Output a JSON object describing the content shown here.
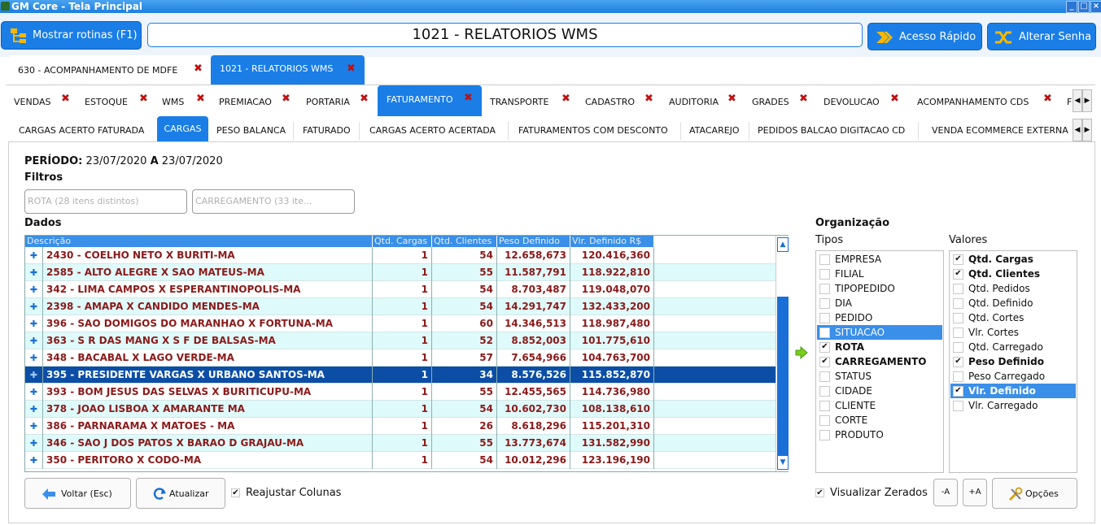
{
  "window": {
    "title": "GM Core - Tela Principal",
    "controls": [
      "_",
      "□",
      "×"
    ]
  },
  "header": {
    "routines_label": "Mostrar rotinas (F1)",
    "title": "1021 - RELATORIOS WMS",
    "quick_access_label": "Acesso Rápido",
    "change_password_label": "Alterar Senha"
  },
  "main_tabs": [
    {
      "label": "630 - ACOMPANHAMENTO DE MDFE",
      "active": false
    },
    {
      "label": "1021 - RELATORIOS WMS",
      "active": true
    }
  ],
  "module_tabs": [
    {
      "label": "VENDAS"
    },
    {
      "label": "ESTOQUE"
    },
    {
      "label": "WMS"
    },
    {
      "label": "PREMIACAO"
    },
    {
      "label": "PORTARIA"
    },
    {
      "label": "FATURAMENTO",
      "active": true
    },
    {
      "label": "TRANSPORTE"
    },
    {
      "label": "CADASTRO"
    },
    {
      "label": "AUDITORIA"
    },
    {
      "label": "GRADES"
    },
    {
      "label": "DEVOLUCAO"
    },
    {
      "label": "ACOMPANHAMENTO CDS"
    },
    {
      "label": "F"
    }
  ],
  "sub_tabs": [
    {
      "label": "CARGAS ACERTO FATURADA"
    },
    {
      "label": "CARGAS",
      "active": true
    },
    {
      "label": "PESO BALANCA"
    },
    {
      "label": "FATURADO"
    },
    {
      "label": "CARGAS ACERTO ACERTADA"
    },
    {
      "label": "FATURAMENTOS COM DESCONTO"
    },
    {
      "label": "ATACAREJO"
    },
    {
      "label": "PEDIDOS BALCAO DIGITACAO CD"
    },
    {
      "label": "VENDA ECOMMERCE EXTERNA"
    }
  ],
  "period": {
    "label": "PERÍODO:",
    "start": "23/07/2020",
    "connector": "A",
    "end": "23/07/2020"
  },
  "filters": {
    "title": "Filtros",
    "rota_placeholder": "ROTA (28 itens distintos)",
    "carregamento_placeholder": "CARREGAMENTO (33 ite..."
  },
  "grid": {
    "title": "Dados",
    "columns": [
      "Descrição",
      "Qtd. Cargas",
      "Qtd. Clientes",
      "Peso Definido",
      "Vlr. Definido R$"
    ],
    "rows": [
      {
        "desc": "2430 - COELHO NETO X BURITI-MA",
        "cargas": "1",
        "clientes": "54",
        "peso": "12.658,673",
        "valor": "120.416,360"
      },
      {
        "desc": "2585 - ALTO ALEGRE X SAO MATEUS-MA",
        "cargas": "1",
        "clientes": "55",
        "peso": "11.587,791",
        "valor": "118.922,810"
      },
      {
        "desc": "342 - LIMA CAMPOS X ESPERANTINOPOLIS-MA",
        "cargas": "1",
        "clientes": "54",
        "peso": "8.703,487",
        "valor": "119.048,070"
      },
      {
        "desc": "2398 - AMAPA X CANDIDO MENDES-MA",
        "cargas": "1",
        "clientes": "54",
        "peso": "14.291,747",
        "valor": "132.433,200"
      },
      {
        "desc": "396 - SAO DOMIGOS DO MARANHAO X FORTUNA-MA",
        "cargas": "1",
        "clientes": "60",
        "peso": "14.346,513",
        "valor": "118.987,480"
      },
      {
        "desc": "363 - S R DAS MANG X S F DE BALSAS-MA",
        "cargas": "1",
        "clientes": "52",
        "peso": "8.852,003",
        "valor": "101.775,610"
      },
      {
        "desc": "348 - BACABAL X LAGO VERDE-MA",
        "cargas": "1",
        "clientes": "57",
        "peso": "7.654,966",
        "valor": "104.763,700"
      },
      {
        "desc": "395 - PRESIDENTE VARGAS X URBANO SANTOS-MA",
        "cargas": "1",
        "clientes": "34",
        "peso": "8.576,526",
        "valor": "115.852,870",
        "selected": true
      },
      {
        "desc": "393 - BOM JESUS DAS SELVAS X BURITICUPU-MA",
        "cargas": "1",
        "clientes": "55",
        "peso": "12.455,565",
        "valor": "114.736,980"
      },
      {
        "desc": "378 - JOAO LISBOA  X AMARANTE  MA",
        "cargas": "1",
        "clientes": "54",
        "peso": "10.602,730",
        "valor": "108.138,610"
      },
      {
        "desc": "386 - PARNARAMA X MATOES - MA",
        "cargas": "1",
        "clientes": "26",
        "peso": "8.618,296",
        "valor": "115.201,310"
      },
      {
        "desc": "346 - SAO J DOS PATOS X BARAO D GRAJAU-MA",
        "cargas": "1",
        "clientes": "55",
        "peso": "13.773,674",
        "valor": "131.582,990"
      },
      {
        "desc": "350 - PERITORO X CODO-MA",
        "cargas": "1",
        "clientes": "54",
        "peso": "10.012,296",
        "valor": "123.196,190"
      }
    ]
  },
  "organization": {
    "title": "Organização",
    "types_label": "Tipos",
    "values_label": "Valores",
    "types": [
      {
        "label": "EMPRESA",
        "checked": false
      },
      {
        "label": "FILIAL",
        "checked": false
      },
      {
        "label": "TIPOPEDIDO",
        "checked": false
      },
      {
        "label": "DIA",
        "checked": false
      },
      {
        "label": "PEDIDO",
        "checked": false
      },
      {
        "label": "SITUACAO",
        "checked": false,
        "selected": true
      },
      {
        "label": "ROTA",
        "checked": true
      },
      {
        "label": "CARREGAMENTO",
        "checked": true
      },
      {
        "label": "STATUS",
        "checked": false
      },
      {
        "label": "CIDADE",
        "checked": false
      },
      {
        "label": "CLIENTE",
        "checked": false
      },
      {
        "label": "CORTE",
        "checked": false
      },
      {
        "label": "PRODUTO",
        "checked": false
      }
    ],
    "values": [
      {
        "label": "Qtd. Cargas",
        "checked": true
      },
      {
        "label": "Qtd. Clientes",
        "checked": true
      },
      {
        "label": "Qtd. Pedidos",
        "checked": false
      },
      {
        "label": "Qtd. Definido",
        "checked": false
      },
      {
        "label": "Qtd. Cortes",
        "checked": false
      },
      {
        "label": "Vlr. Cortes",
        "checked": false
      },
      {
        "label": "Qtd. Carregado",
        "checked": false
      },
      {
        "label": "Peso Definido",
        "checked": true
      },
      {
        "label": "Peso Carregado",
        "checked": false
      },
      {
        "label": "Vlr. Definido",
        "checked": true,
        "selected": true
      },
      {
        "label": "Vlr. Carregado",
        "checked": false
      }
    ]
  },
  "footer": {
    "back_label": "Voltar (Esc)",
    "refresh_label": "Atualizar",
    "readjust_label": "Reajustar Colunas",
    "show_zeros_label": "Visualizar Zerados",
    "font_minus_label": "-A",
    "font_plus_label": "+A",
    "options_label": "Opções"
  },
  "colors": {
    "accent": "#1a7ee6",
    "row_text": "#8b1a1a",
    "row_alt": "#dffafa",
    "selected_row": "#0c4ea6"
  }
}
